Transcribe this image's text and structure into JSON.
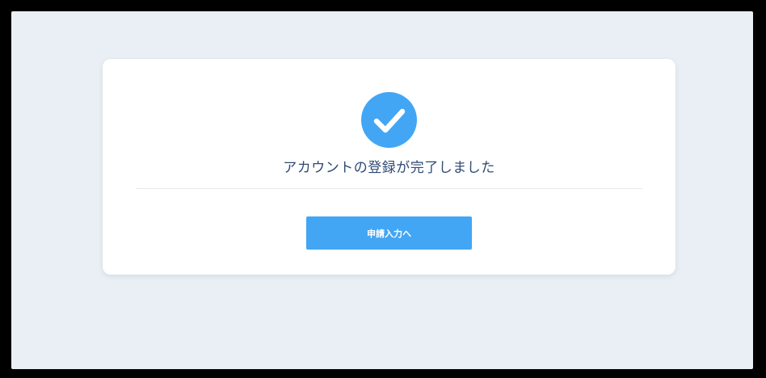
{
  "completion": {
    "icon": "checkmark-icon",
    "message": "アカウントの登録が完了しました",
    "button_label": "申請入力へ"
  },
  "colors": {
    "background": "#e9eff4",
    "card": "#ffffff",
    "accent": "#42a6f5",
    "title_text": "#2f4a74"
  }
}
